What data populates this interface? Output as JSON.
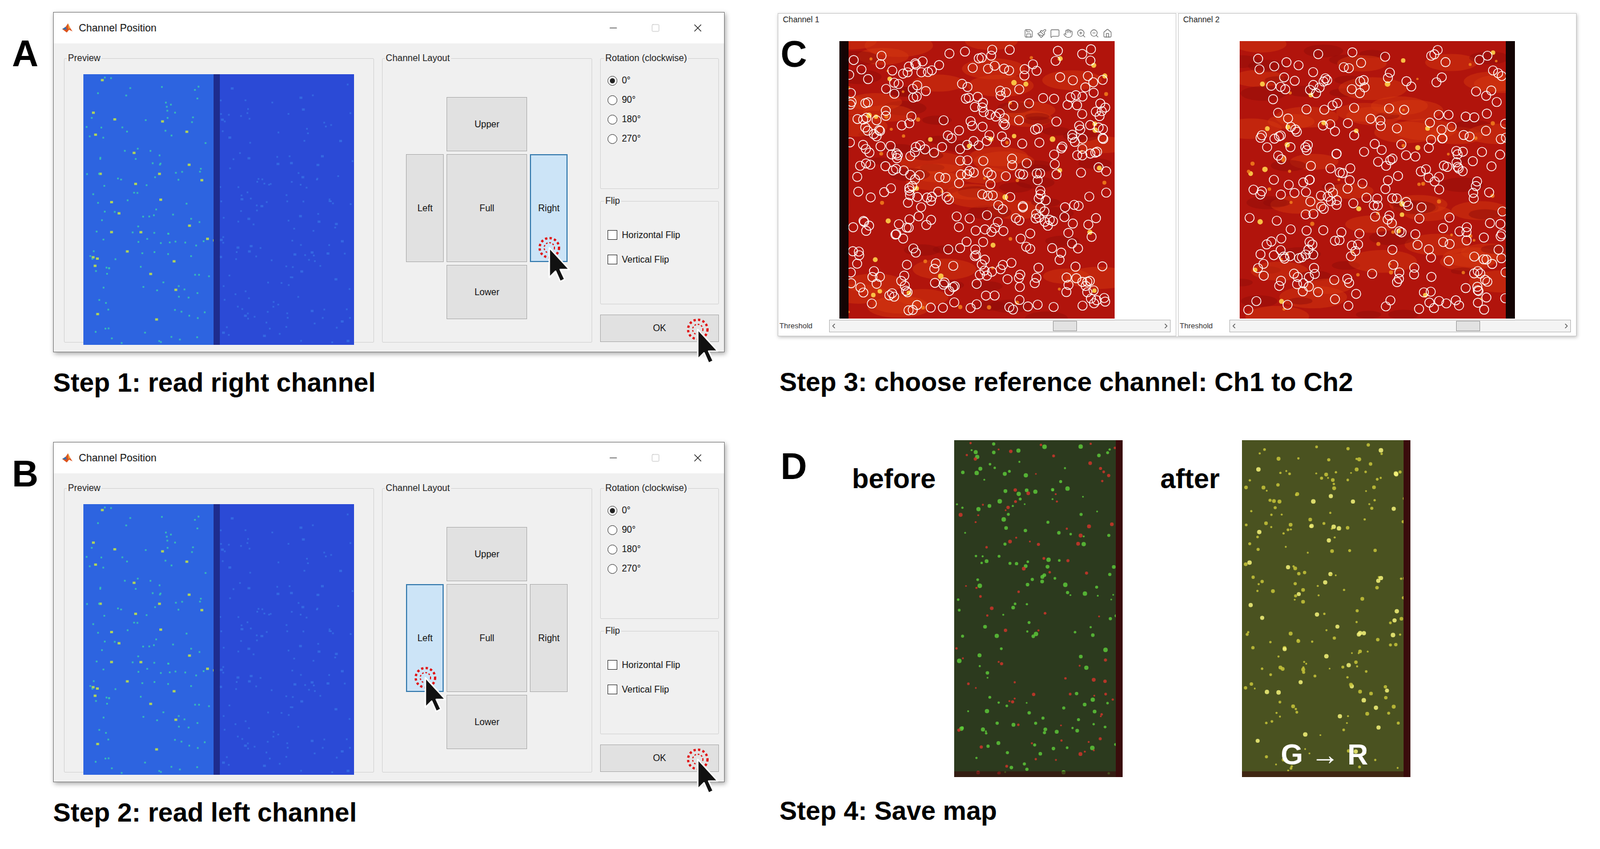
{
  "panel_a": {
    "label": "A",
    "caption": "Step 1: read right channel",
    "dialog": {
      "title": "Channel Position",
      "preview": {
        "title": "Preview"
      },
      "layout": {
        "title": "Channel Layout",
        "buttons": [
          {
            "label": "Upper",
            "selected": false
          },
          {
            "label": "Left",
            "selected": false
          },
          {
            "label": "Full",
            "selected": false
          },
          {
            "label": "Right",
            "selected": true
          },
          {
            "label": "Lower",
            "selected": false
          }
        ]
      },
      "rotation": {
        "title": "Rotation (clockwise)",
        "options": [
          {
            "label": "0°",
            "selected": true
          },
          {
            "label": "90°",
            "selected": false
          },
          {
            "label": "180°",
            "selected": false
          },
          {
            "label": "270°",
            "selected": false
          }
        ]
      },
      "flip": {
        "title": "Flip",
        "options": [
          {
            "label": "Horizontal Flip",
            "checked": false
          },
          {
            "label": "Vertical Flip",
            "checked": false
          }
        ]
      },
      "ok": {
        "label": "OK",
        "clicked": true
      }
    }
  },
  "panel_b": {
    "label": "B",
    "caption": "Step 2: read left channel",
    "dialog": {
      "title": "Channel Position",
      "preview": {
        "title": "Preview"
      },
      "layout": {
        "title": "Channel Layout",
        "buttons": [
          {
            "label": "Upper",
            "selected": false
          },
          {
            "label": "Left",
            "selected": true
          },
          {
            "label": "Full",
            "selected": false
          },
          {
            "label": "Right",
            "selected": false
          },
          {
            "label": "Lower",
            "selected": false
          }
        ]
      },
      "rotation": {
        "title": "Rotation (clockwise)",
        "options": [
          {
            "label": "0°",
            "selected": true
          },
          {
            "label": "90°",
            "selected": false
          },
          {
            "label": "180°",
            "selected": false
          },
          {
            "label": "270°",
            "selected": false
          }
        ]
      },
      "flip": {
        "title": "Flip",
        "options": [
          {
            "label": "Horizontal Flip",
            "checked": false
          },
          {
            "label": "Vertical Flip",
            "checked": false
          }
        ]
      },
      "ok": {
        "label": "OK",
        "clicked": true
      }
    }
  },
  "panel_c": {
    "label": "C",
    "caption": "Step 3: choose reference channel: Ch1 to Ch2",
    "axes": [
      {
        "title": "Channel 1",
        "toolbar": true,
        "dark_edge": "left",
        "slider": {
          "label": "Threshold",
          "level": 0.7
        }
      },
      {
        "title": "Channel 2",
        "toolbar": false,
        "dark_edge": "right",
        "slider": {
          "label": "Threshold",
          "level": 0.71
        }
      }
    ]
  },
  "panel_d": {
    "label": "D",
    "caption": "Step 4: Save map",
    "images": [
      {
        "label": "before",
        "kind": "unaligned"
      },
      {
        "label": "after",
        "kind": "aligned",
        "overlay": "G → R"
      }
    ]
  }
}
